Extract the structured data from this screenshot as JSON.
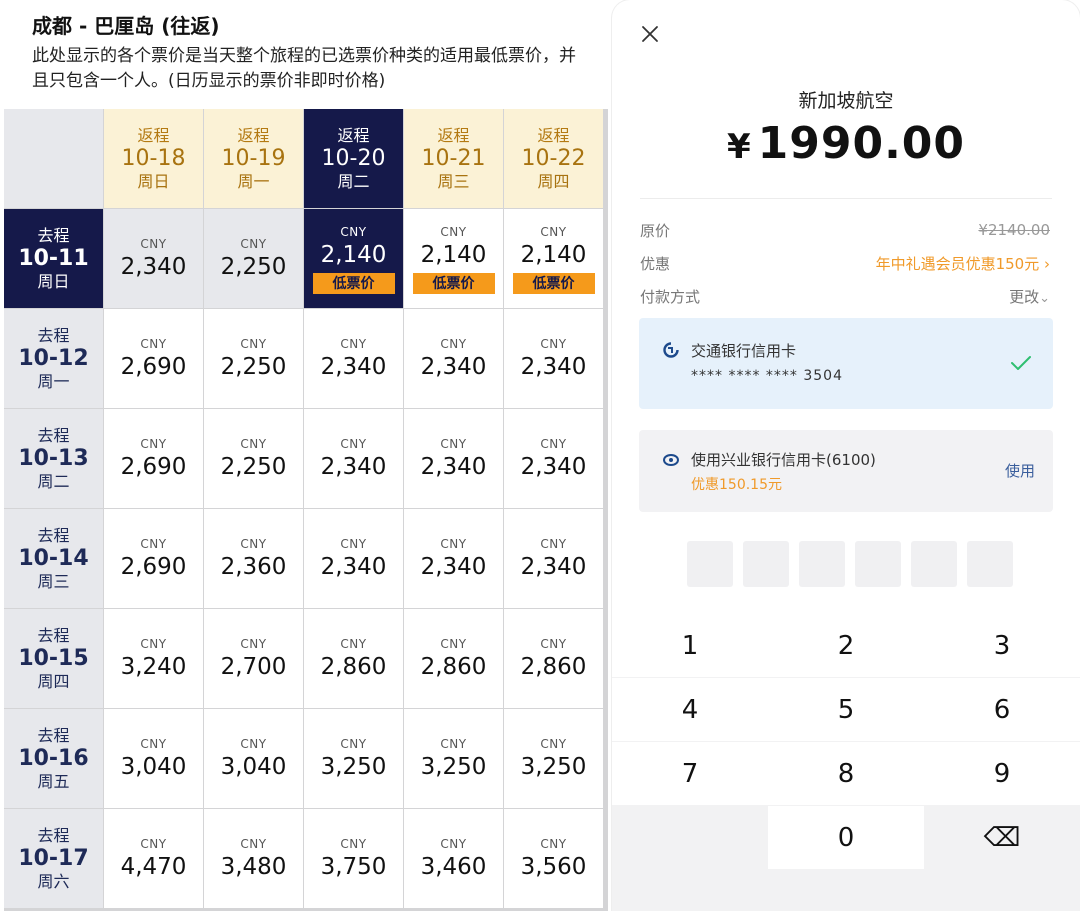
{
  "left": {
    "title": "成都 - 巴厘岛 (往返)",
    "description": "此处显示的各个票价是当天整个旅程的已选票价种类的适用最低票价，并且只包含一个人。(日历显示的票价非即时价格)",
    "return_label": "返程",
    "depart_label": "去程",
    "currency": "CNY",
    "lowest_tag": "低票价",
    "columns": [
      {
        "date": "10-18",
        "weekday": "周日"
      },
      {
        "date": "10-19",
        "weekday": "周一"
      },
      {
        "date": "10-20",
        "weekday": "周二"
      },
      {
        "date": "10-21",
        "weekday": "周三"
      },
      {
        "date": "10-22",
        "weekday": "周四"
      }
    ],
    "rows": [
      {
        "date": "10-11",
        "weekday": "周日",
        "prices": [
          "2,340",
          "2,250",
          "2,140",
          "2,140",
          "2,140"
        ]
      },
      {
        "date": "10-12",
        "weekday": "周一",
        "prices": [
          "2,690",
          "2,250",
          "2,340",
          "2,340",
          "2,340"
        ]
      },
      {
        "date": "10-13",
        "weekday": "周二",
        "prices": [
          "2,690",
          "2,250",
          "2,340",
          "2,340",
          "2,340"
        ]
      },
      {
        "date": "10-14",
        "weekday": "周三",
        "prices": [
          "2,690",
          "2,360",
          "2,340",
          "2,340",
          "2,340"
        ]
      },
      {
        "date": "10-15",
        "weekday": "周四",
        "prices": [
          "3,240",
          "2,700",
          "2,860",
          "2,860",
          "2,860"
        ]
      },
      {
        "date": "10-16",
        "weekday": "周五",
        "prices": [
          "3,040",
          "3,040",
          "3,250",
          "3,250",
          "3,250"
        ]
      },
      {
        "date": "10-17",
        "weekday": "周六",
        "prices": [
          "4,470",
          "3,480",
          "3,750",
          "3,460",
          "3,560"
        ]
      }
    ],
    "selected_row": 0,
    "selected_col": 2,
    "colors": {
      "navy": "#15194a",
      "gold_bg": "#fbf2d6",
      "orange_tag": "#f59a1b"
    }
  },
  "payment": {
    "airline": "新加坡航空",
    "currency_symbol": "¥",
    "amount": "1990.00",
    "original_price_label": "原价",
    "original_price": "¥2140.00",
    "discount_label": "优惠",
    "discount_value": "年中礼遇会员优惠150元",
    "discount_chevron": "›",
    "pay_method_label": "付款方式",
    "change_label": "更改",
    "change_chevron": "⌄",
    "card1": {
      "icon": "bankcomm-icon",
      "name": "交通银行信用卡",
      "number": "**** **** **** 3504"
    },
    "card2": {
      "icon": "cib-icon",
      "name": "使用兴业银行信用卡(6100)",
      "promo": "优惠150.15元",
      "action": "使用"
    }
  },
  "keypad": {
    "keys": [
      "1",
      "2",
      "3",
      "4",
      "5",
      "6",
      "7",
      "8",
      "9",
      "",
      "0",
      "⌫"
    ]
  }
}
